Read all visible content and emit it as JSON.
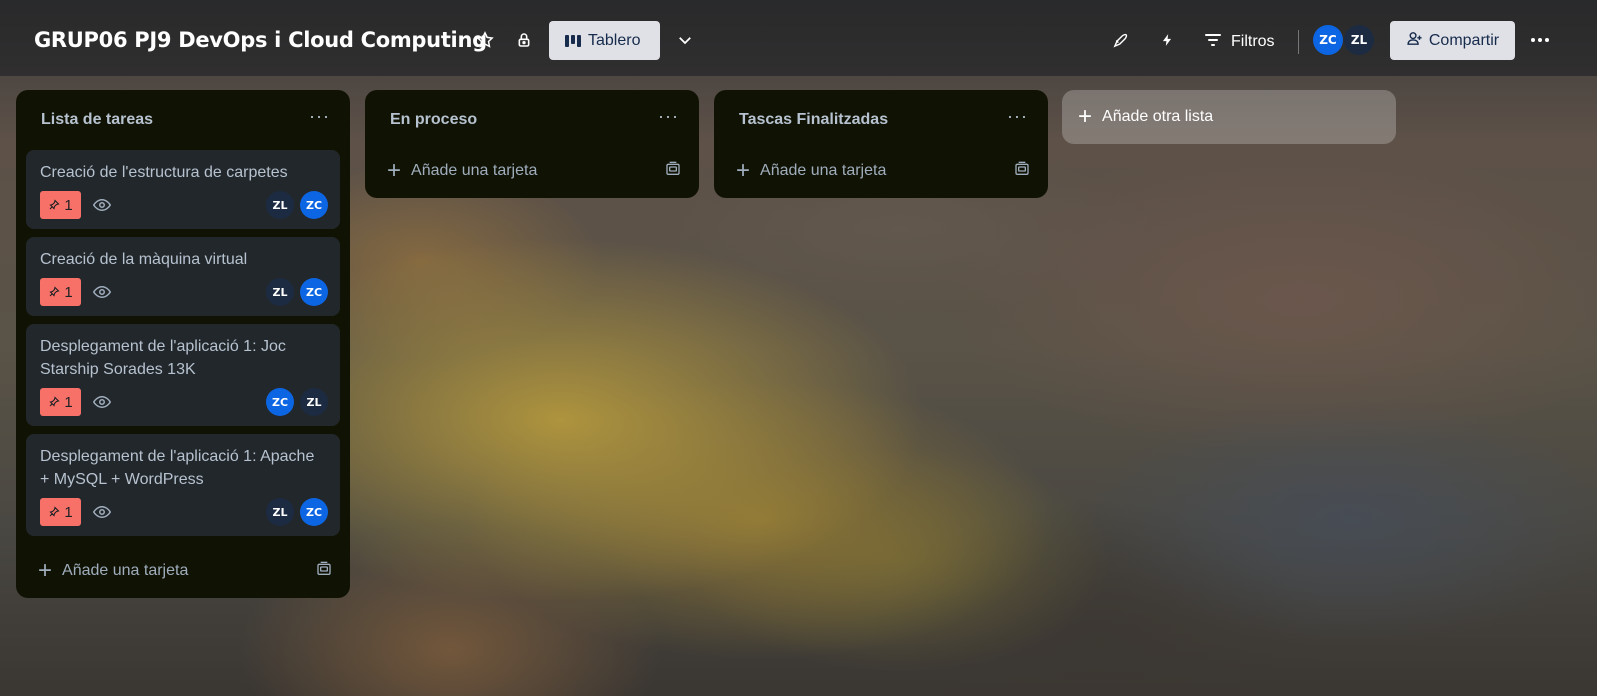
{
  "board": {
    "title": "GRUP06 PJ9 DevOps i Cloud Computing",
    "view_label": "Tablero",
    "filters_label": "Filtros",
    "share_label": "Compartir",
    "members": [
      {
        "initials": "ZC",
        "color": "#0c66e4"
      },
      {
        "initials": "ZL",
        "color": "#1c2b41"
      }
    ]
  },
  "lists": [
    {
      "title": "Lista de tareas",
      "add_card_label": "Añade una tarjeta",
      "cards": [
        {
          "title": "Creació de l'estructura de carpetes",
          "badge_count": "1",
          "members": [
            "ZL",
            "ZC"
          ]
        },
        {
          "title": "Creació de la màquina virtual",
          "badge_count": "1",
          "members": [
            "ZL",
            "ZC"
          ]
        },
        {
          "title": "Desplegament de l'aplicació 1: Joc Starship Sorades 13K",
          "badge_count": "1",
          "members": [
            "ZC",
            "ZL"
          ]
        },
        {
          "title": "Desplegament de l'aplicació 1: Apache + MySQL + WordPress",
          "badge_count": "1",
          "members": [
            "ZL",
            "ZC"
          ]
        }
      ]
    },
    {
      "title": "En proceso",
      "add_card_label": "Añade una tarjeta",
      "cards": []
    },
    {
      "title": "Tascas Finalitzadas",
      "add_card_label": "Añade una tarjeta",
      "cards": []
    }
  ],
  "add_list_label": "Añade otra lista",
  "colors": {
    "badge_red": "#f87168",
    "list_bg": "#101204",
    "card_bg": "#22272b",
    "member_zc": "#0c66e4",
    "member_zl": "#1c2b41"
  }
}
